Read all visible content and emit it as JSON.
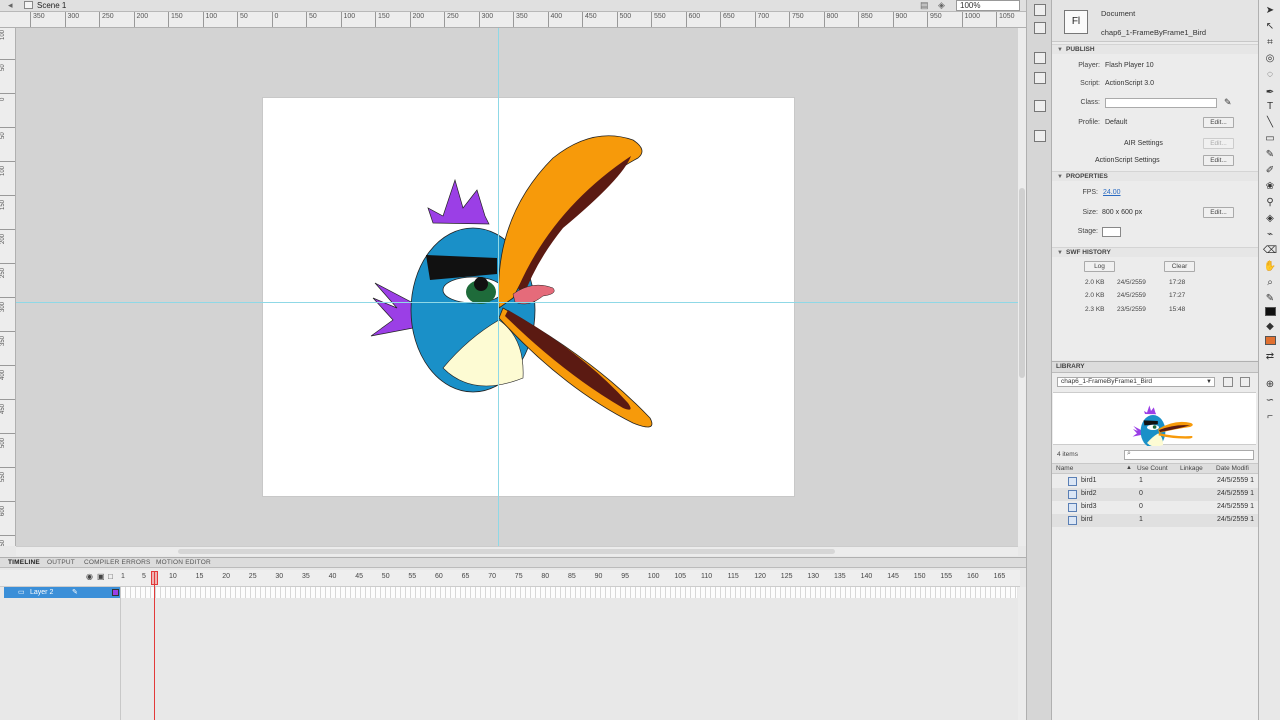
{
  "editbar": {
    "scene_label": "Scene 1",
    "zoom_value": "100%"
  },
  "rulers": {
    "h_ticks": [
      "350",
      "300",
      "250",
      "200",
      "150",
      "100",
      "50",
      "0",
      "50",
      "100",
      "150",
      "200",
      "250",
      "300",
      "350",
      "400",
      "450",
      "500",
      "550",
      "600",
      "650",
      "700",
      "750",
      "800",
      "850",
      "900",
      "950",
      "1000",
      "1050"
    ],
    "v_ticks": [
      "100",
      "50",
      "0",
      "50",
      "100",
      "150",
      "200",
      "250",
      "300",
      "350",
      "400",
      "450",
      "500",
      "550",
      "600",
      "650"
    ]
  },
  "timeline": {
    "tabs": [
      "TIMELINE",
      "OUTPUT",
      "COMPILER ERRORS",
      "MOTION EDITOR"
    ],
    "frame_numbers": [
      "1",
      "5",
      "10",
      "15",
      "20",
      "25",
      "30",
      "35",
      "40",
      "45",
      "50",
      "55",
      "60",
      "65",
      "70",
      "75",
      "80",
      "85",
      "90",
      "95",
      "100",
      "105",
      "110",
      "115",
      "120",
      "125",
      "130",
      "135",
      "140",
      "145",
      "150",
      "155",
      "160",
      "165"
    ],
    "layer_name": "Layer 2"
  },
  "properties": {
    "doc_logo": "Fl",
    "doc_type": "Document",
    "doc_name": "chap6_1-FrameByFrame1_Bird",
    "publish_header": "PUBLISH",
    "player_label": "Player:",
    "player_value": "Flash Player 10",
    "script_label": "Script:",
    "script_value": "ActionScript 3.0",
    "class_label": "Class:",
    "profile_label": "Profile:",
    "profile_value": "Default",
    "edit_label": "Edit...",
    "air_settings": "AIR Settings",
    "as_settings": "ActionScript Settings",
    "properties_header": "PROPERTIES",
    "fps_label": "FPS:",
    "fps_value": "24.00",
    "size_label": "Size:",
    "size_value": "800 x 600 px",
    "stage_label": "Stage:",
    "stage_color": "#ffffff",
    "swf_history_header": "SWF HISTORY",
    "log_label": "Log",
    "clear_label": "Clear",
    "history": [
      {
        "size": "2.0 KB",
        "date": "24/5/2559",
        "time": "17:28"
      },
      {
        "size": "2.0 KB",
        "date": "24/5/2559",
        "time": "17:27"
      },
      {
        "size": "2.3 KB",
        "date": "23/5/2559",
        "time": "15:48"
      }
    ]
  },
  "library": {
    "header": "LIBRARY",
    "selected_doc": "chap6_1-FrameByFrame1_Bird",
    "items_count": "4 items",
    "columns": {
      "name": "Name",
      "use_count": "Use Count",
      "linkage": "Linkage",
      "date": "Date Modifi"
    },
    "items": [
      {
        "name": "bird1",
        "use": "1",
        "date": "24/5/2559 1"
      },
      {
        "name": "bird2",
        "use": "0",
        "date": "24/5/2559 1"
      },
      {
        "name": "bird3",
        "use": "0",
        "date": "24/5/2559 1"
      },
      {
        "name": "bird",
        "use": "1",
        "date": "24/5/2559 1"
      }
    ]
  },
  "colors": {
    "accent": "#3b8fd8",
    "playhead": "#e23a3a",
    "guide": "#8fd8e6",
    "stage_bg": "#d3d3d3"
  }
}
